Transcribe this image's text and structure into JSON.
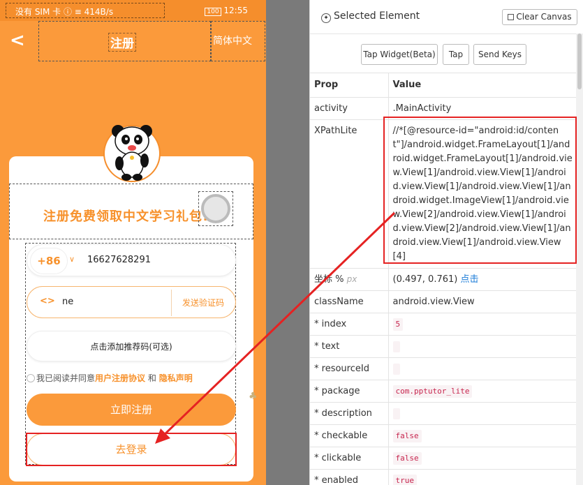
{
  "phone": {
    "status": {
      "left": "没有 SIM 卡 ⓘ ≡ 414B/s",
      "battery": "100",
      "time": "12:55"
    },
    "nav": {
      "back": "<",
      "title": "注册",
      "lang": "简体中文"
    },
    "headline": "注册免费领取中文学习礼包!",
    "phone_field": {
      "country_code": "+86",
      "number": "16627628291"
    },
    "code_field": {
      "icon": "<>",
      "value": "ne",
      "send_code": "发送验证码"
    },
    "referral_placeholder": "点击添加推荐码(可选)",
    "agreement": {
      "prefix": "我已阅读并同意",
      "terms": "用户注册协议",
      "and": "和",
      "privacy": "隐私声明"
    },
    "register_button": "立即注册",
    "login_button": "去登录"
  },
  "inspector": {
    "title": "Selected Element",
    "clear_canvas": "Clear Canvas",
    "actions": [
      "Tap Widget(Beta)",
      "Tap",
      "Send Keys"
    ],
    "headers": {
      "prop": "Prop",
      "value": "Value"
    },
    "props": {
      "activity": ".MainActivity",
      "xpath_label": "XPathLite",
      "xpath": "//*[@resource-id=\"android:id/content\"]/android.widget.FrameLayout[1]/android.widget.FrameLayout[1]/android.view.View[1]/android.view.View[1]/android.view.View[1]/android.view.View[1]/android.widget.ImageView[1]/android.view.View[2]/android.view.View[1]/android.view.View[2]/android.view.View[1]/android.view.View[1]/android.view.View[4]",
      "coord_label": "坐标 %",
      "coord_unit": "px",
      "coord_value": "(0.497, 0.761)",
      "coord_link": "点击",
      "className": "android.view.View",
      "index": "5",
      "package": "com.pptutor_lite",
      "checkable": "false",
      "clickable": "false",
      "enabled": "true"
    },
    "keys": {
      "activity": "activity",
      "className": "className",
      "index": "* index",
      "text": "* text",
      "resourceId": "* resourceId",
      "package": "* package",
      "description": "* description",
      "checkable": "* checkable",
      "clickable": "* clickable",
      "enabled": "* enabled"
    }
  },
  "colors": {
    "accent": "#fb9a3b",
    "highlight": "#e52222",
    "link": "#1a7bd8"
  }
}
